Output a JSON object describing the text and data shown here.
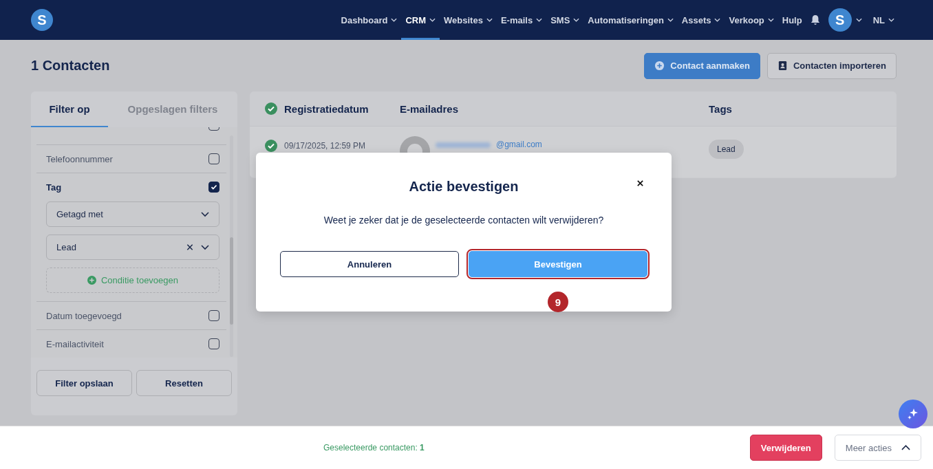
{
  "nav": {
    "logo": "S",
    "items": [
      {
        "label": "Dashboard",
        "dropdown": true,
        "selected": false
      },
      {
        "label": "CRM",
        "dropdown": true,
        "selected": true
      },
      {
        "label": "Websites",
        "dropdown": true,
        "selected": false
      },
      {
        "label": "E-mails",
        "dropdown": true,
        "selected": false
      },
      {
        "label": "SMS",
        "dropdown": true,
        "selected": false
      },
      {
        "label": "Automatiseringen",
        "dropdown": true,
        "selected": false
      },
      {
        "label": "Assets",
        "dropdown": true,
        "selected": false
      },
      {
        "label": "Verkoop",
        "dropdown": true,
        "selected": false
      },
      {
        "label": "Hulp",
        "dropdown": false,
        "selected": false
      }
    ],
    "avatar": "S",
    "language": "NL"
  },
  "page": {
    "title": "1 Contacten",
    "actions": [
      {
        "label": "Contact aanmaken",
        "kind": "primary"
      },
      {
        "label": "Contacten importeren",
        "kind": "secondary"
      }
    ]
  },
  "filter_panel": {
    "tabs": [
      {
        "label": "Filter op",
        "selected": true
      },
      {
        "label": "Opgeslagen filters",
        "selected": false
      }
    ],
    "filters": [
      {
        "label": "Telefoonnummer",
        "checked": false
      },
      {
        "label": "Tag",
        "checked": true,
        "conditions": [
          {
            "value": "Getagd met",
            "clearable": false
          },
          {
            "value": "Lead",
            "clearable": true
          }
        ],
        "add_condition": "Conditie toevoegen"
      },
      {
        "label": "Datum toegevoegd",
        "checked": false
      },
      {
        "label": "E-mailactiviteit",
        "checked": false
      }
    ],
    "buttons": [
      "Filter opslaan",
      "Resetten"
    ]
  },
  "table": {
    "columns": [
      "Registratiedatum",
      "E-mailadres",
      "Tags"
    ],
    "all_checked": true,
    "rows": [
      {
        "checked": true,
        "date": "09/17/2025, 12:59 PM",
        "email": "@gmail.com",
        "tag": "Lead"
      }
    ]
  },
  "dialog": {
    "title": "Actie bevestigen",
    "message": "Weet je zeker dat je de geselecteerde contacten wilt verwijderen?",
    "buttons": [
      {
        "label": "Annuleren",
        "kind": "secondary",
        "highlighted": false
      },
      {
        "label": "Bevestigen",
        "kind": "primary",
        "highlighted": true
      }
    ],
    "step_badge": "9"
  },
  "footer": {
    "selection": "Geselecteerde contacten: **1**",
    "buttons": [
      {
        "label": "Verwijderen",
        "kind": "danger"
      },
      {
        "label": "Meer acties",
        "kind": "menu"
      }
    ]
  }
}
